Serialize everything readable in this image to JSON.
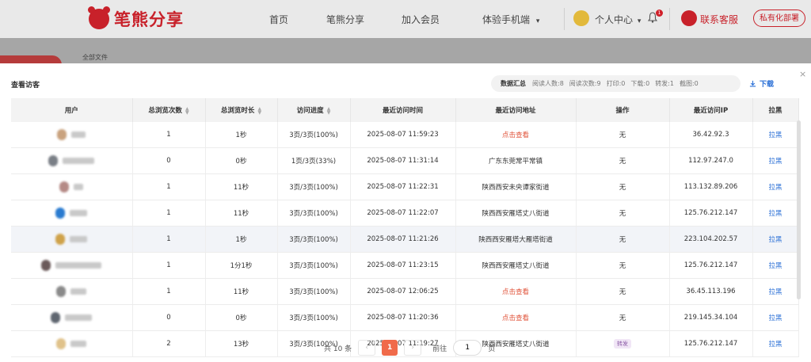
{
  "brand": {
    "name": "笔熊分享",
    "color": "#c8212a"
  },
  "nav": {
    "items": [
      "首页",
      "笔熊分享",
      "加入会员",
      "体验手机端"
    ],
    "mobile_caret": "▾",
    "user_center": "个人中心",
    "user_center_caret": "▾",
    "bell_badge": "1",
    "service": "联系客服",
    "private_deploy": "私有化部署"
  },
  "background": {
    "breadcrumb": "全部文件"
  },
  "modal": {
    "title": "查看访客",
    "close_icon": "×",
    "summary": {
      "label": "数据汇总",
      "readers": "阅读人数:8",
      "reads": "阅读次数:9",
      "prints": "打印:0",
      "downloads": "下载:0",
      "shares": "转发:1",
      "screenshots": "截图:0"
    },
    "download_label": "下载",
    "columns": [
      "用户",
      "总浏览次数",
      "总浏览时长",
      "访问进度",
      "最近访问时间",
      "最近访问地址",
      "操作",
      "最近访问IP",
      "拉黑"
    ],
    "sortable_columns": [
      1,
      2,
      3
    ],
    "rows": [
      {
        "views": "1",
        "duration": "1秒",
        "progress": "3页/3页(100%)",
        "time": "2025-08-07 11:59:23",
        "address": "点击查看",
        "address_link": true,
        "op": "无",
        "op_tag": false,
        "ip": "36.42.92.3",
        "block": "拉黑",
        "avatar_color": "#c9a27e",
        "name_width": 18
      },
      {
        "views": "0",
        "duration": "0秒",
        "progress": "1页/3页(33%)",
        "time": "2025-08-07 11:31:14",
        "address": "广东东莞常平常镇",
        "address_link": false,
        "op": "无",
        "op_tag": false,
        "ip": "112.97.247.0",
        "block": "拉黑",
        "avatar_color": "#7a7f86",
        "name_width": 40
      },
      {
        "views": "1",
        "duration": "11秒",
        "progress": "3页/3页(100%)",
        "time": "2025-08-07 11:22:31",
        "address": "陕西西安未央谭家街道",
        "address_link": false,
        "op": "无",
        "op_tag": false,
        "ip": "113.132.89.206",
        "block": "拉黑",
        "avatar_color": "#b58a86",
        "name_width": 12
      },
      {
        "views": "1",
        "duration": "11秒",
        "progress": "3页/3页(100%)",
        "time": "2025-08-07 11:22:07",
        "address": "陕西西安雁塔丈八街道",
        "address_link": false,
        "op": "无",
        "op_tag": false,
        "ip": "125.76.212.147",
        "block": "拉黑",
        "avatar_color": "#2a7bd0",
        "name_width": 22
      },
      {
        "views": "1",
        "duration": "1秒",
        "progress": "3页/3页(100%)",
        "time": "2025-08-07 11:21:26",
        "address": "陕西西安雁塔大雁塔街道",
        "address_link": false,
        "op": "无",
        "op_tag": false,
        "ip": "223.104.202.57",
        "block": "拉黑",
        "avatar_color": "#cfa24a",
        "name_width": 22
      },
      {
        "views": "1",
        "duration": "1分1秒",
        "progress": "3页/3页(100%)",
        "time": "2025-08-07 11:23:15",
        "address": "陕西西安雁塔丈八街道",
        "address_link": false,
        "op": "无",
        "op_tag": false,
        "ip": "125.76.212.147",
        "block": "拉黑",
        "avatar_color": "#6b5a5a",
        "name_width": 58
      },
      {
        "views": "1",
        "duration": "11秒",
        "progress": "3页/3页(100%)",
        "time": "2025-08-07 12:06:25",
        "address": "点击查看",
        "address_link": true,
        "op": "无",
        "op_tag": false,
        "ip": "36.45.113.196",
        "block": "拉黑",
        "avatar_color": "#8a8a8a",
        "name_width": 20
      },
      {
        "views": "0",
        "duration": "0秒",
        "progress": "3页/3页(100%)",
        "time": "2025-08-07 11:20:36",
        "address": "点击查看",
        "address_link": true,
        "op": "无",
        "op_tag": false,
        "ip": "219.145.34.104",
        "block": "拉黑",
        "avatar_color": "#5f6670",
        "name_width": 34
      },
      {
        "views": "2",
        "duration": "13秒",
        "progress": "3页/3页(100%)",
        "time": "2025-08-07 11:19:27",
        "address": "陕西西安雁塔丈八街道",
        "address_link": false,
        "op": "转发",
        "op_tag": true,
        "ip": "125.76.212.147",
        "block": "拉黑",
        "avatar_color": "#e0c28a",
        "name_width": 20
      }
    ],
    "highlighted_row": 4,
    "pagination": {
      "total": "共 10 条",
      "prev": "‹",
      "current": "1",
      "next": "›",
      "goto_label": "前往",
      "goto_value": "1",
      "page_unit": "页"
    }
  },
  "colors": {
    "accent_red": "#e0533a",
    "link_blue": "#2a6fd6",
    "pager_active": "#f06a4a"
  }
}
